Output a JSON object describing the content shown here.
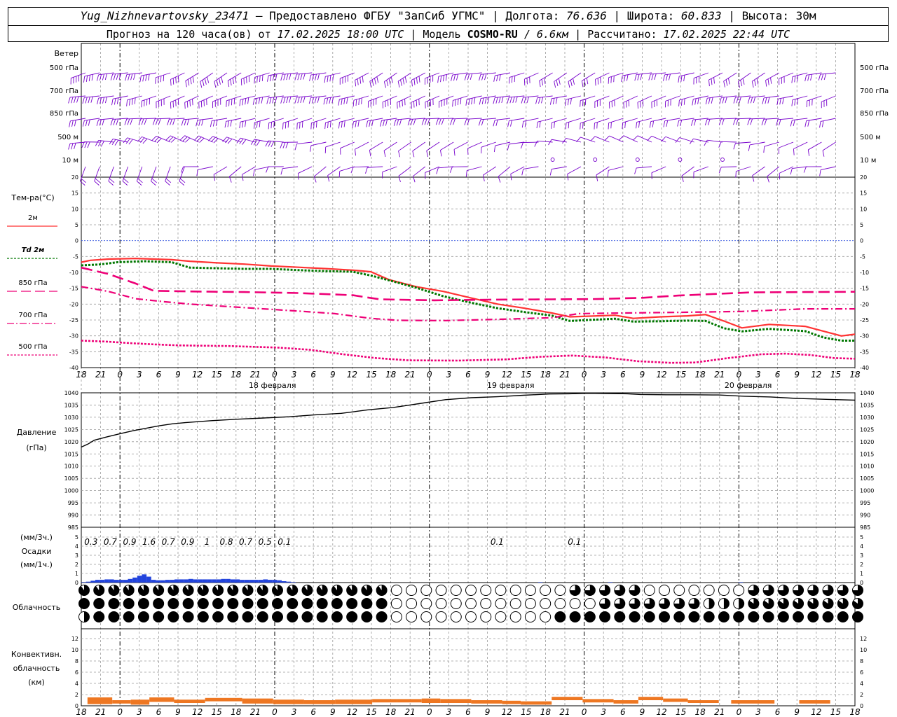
{
  "header": {
    "station": "Yug_Nizhnevartovsky_23471",
    "provided_by": "– Предоставлено ФГБУ \"ЗапСиб УГМС\"",
    "lon_label": "Долгота:",
    "lon": "76.636",
    "lat_label": "Широта:",
    "lat": "60.833",
    "alt_label": "Высота:",
    "alt": "30м",
    "sep": "|",
    "forecast_prefix": "Прогноз на 120 часа(ов) от",
    "forecast_time": "17.02.2025 18:00 UTC",
    "model_label": "Модель",
    "model": "COSMO-RU",
    "model_res": "/ 6.6км",
    "computed_label": "Рассчитано:",
    "computed": "17.02.2025 22:44 UTC"
  },
  "colors": {
    "t2m": "#ff3333",
    "td2m": "#007700",
    "upper": "#ee0077",
    "wind": "#7700cc",
    "pressure": "#000000",
    "precip": "#2244dd",
    "convective": "#ee7722",
    "zero_line": "#3355dd"
  },
  "chart_data": [
    {
      "type": "barbs",
      "title": "Ветер",
      "levels": [
        "500 гПа",
        "700 гПа",
        "850 гПа",
        "500 м",
        "10 м"
      ]
    },
    {
      "type": "line",
      "ylabel": "Тем-ра(°C)",
      "ylim": [
        -40,
        20
      ],
      "yticks": [
        20,
        15,
        10,
        5,
        0,
        -5,
        -10,
        -15,
        -20,
        -25,
        -30,
        -35,
        -40
      ],
      "x_hours": [
        0,
        120
      ],
      "xtick_labels": [
        "18",
        "21",
        "0",
        "3",
        "6",
        "9",
        "12",
        "15",
        "18",
        "21",
        "0",
        "3",
        "6",
        "9",
        "12",
        "15",
        "18",
        "21",
        "0",
        "3",
        "6",
        "9",
        "12",
        "15",
        "18",
        "21",
        "0",
        "3",
        "6",
        "9",
        "12",
        "15",
        "18",
        "21",
        "0",
        "3",
        "6",
        "9",
        "12",
        "15",
        "18",
        "21",
        "0"
      ],
      "date_labels": [
        "18 февраля",
        "19 февраля",
        "20 февраля"
      ],
      "series": [
        {
          "name": "2м",
          "points": [
            [
              0,
              -6.8
            ],
            [
              2,
              -6.2
            ],
            [
              6,
              -5.8
            ],
            [
              12,
              -5.6
            ],
            [
              20,
              -6
            ],
            [
              24,
              -6.5
            ],
            [
              30,
              -7
            ],
            [
              36,
              -7.4
            ],
            [
              42,
              -8
            ],
            [
              48,
              -8.4
            ],
            [
              54,
              -8.8
            ],
            [
              60,
              -9.3
            ],
            [
              64,
              -9.8
            ],
            [
              68,
              -12.3
            ],
            [
              74,
              -14.5
            ],
            [
              80,
              -16
            ],
            [
              86,
              -18
            ],
            [
              92,
              -20
            ],
            [
              98,
              -21.3
            ],
            [
              104,
              -22.8
            ],
            [
              108,
              -24
            ],
            [
              112,
              -23.8
            ],
            [
              118,
              -23.5
            ],
            [
              122,
              -24.5
            ],
            [
              128,
              -24
            ],
            [
              134,
              -23.7
            ],
            [
              138,
              -23.3
            ],
            [
              142,
              -25.3
            ],
            [
              146,
              -27.5
            ],
            [
              152,
              -26.4
            ],
            [
              160,
              -27
            ],
            [
              164,
              -28.5
            ],
            [
              168,
              -30
            ],
            [
              171,
              -29.5
            ]
          ]
        },
        {
          "name": "Td 2м",
          "points": [
            [
              0,
              -7.8
            ],
            [
              4,
              -7.5
            ],
            [
              8,
              -6.8
            ],
            [
              14,
              -6.5
            ],
            [
              20,
              -6.8
            ],
            [
              24,
              -8.5
            ],
            [
              30,
              -8.7
            ],
            [
              36,
              -8.9
            ],
            [
              42,
              -8.9
            ],
            [
              48,
              -9.3
            ],
            [
              54,
              -9.6
            ],
            [
              60,
              -9.8
            ],
            [
              64,
              -11
            ],
            [
              68,
              -12.5
            ],
            [
              74,
              -14.8
            ],
            [
              80,
              -17.5
            ],
            [
              86,
              -19.5
            ],
            [
              92,
              -21.3
            ],
            [
              98,
              -22.5
            ],
            [
              104,
              -23.6
            ],
            [
              108,
              -25.3
            ],
            [
              112,
              -25
            ],
            [
              118,
              -24.6
            ],
            [
              122,
              -25.5
            ],
            [
              128,
              -25.4
            ],
            [
              134,
              -25.2
            ],
            [
              138,
              -25.3
            ],
            [
              142,
              -27.6
            ],
            [
              146,
              -28.6
            ],
            [
              152,
              -27.8
            ],
            [
              160,
              -28.5
            ],
            [
              164,
              -30.5
            ],
            [
              168,
              -31.5
            ],
            [
              171,
              -31.5
            ]
          ]
        },
        {
          "name": "850 гПа",
          "points": [
            [
              0,
              -8.5
            ],
            [
              6,
              -10.5
            ],
            [
              12,
              -13.5
            ],
            [
              16,
              -15.8
            ],
            [
              24,
              -16
            ],
            [
              36,
              -16.2
            ],
            [
              48,
              -16.5
            ],
            [
              60,
              -17.2
            ],
            [
              66,
              -18.5
            ],
            [
              78,
              -18.8
            ],
            [
              90,
              -18.6
            ],
            [
              104,
              -18.5
            ],
            [
              114,
              -18.4
            ],
            [
              124,
              -18
            ],
            [
              132,
              -17.3
            ],
            [
              140,
              -16.8
            ],
            [
              148,
              -16.3
            ],
            [
              160,
              -16.2
            ],
            [
              171,
              -16.1
            ]
          ]
        },
        {
          "name": "700 гПа",
          "points": [
            [
              0,
              -14.5
            ],
            [
              6,
              -16
            ],
            [
              12,
              -18.3
            ],
            [
              18,
              -19.2
            ],
            [
              24,
              -20
            ],
            [
              36,
              -21.1
            ],
            [
              48,
              -22.2
            ],
            [
              56,
              -23
            ],
            [
              64,
              -24.5
            ],
            [
              70,
              -25.1
            ],
            [
              80,
              -25.2
            ],
            [
              92,
              -24.8
            ],
            [
              104,
              -24.3
            ],
            [
              110,
              -23
            ],
            [
              120,
              -22.8
            ],
            [
              132,
              -22.6
            ],
            [
              146,
              -22.3
            ],
            [
              160,
              -21.5
            ],
            [
              171,
              -21.5
            ]
          ]
        },
        {
          "name": "500 гПа",
          "points": [
            [
              0,
              -31.5
            ],
            [
              6,
              -31.8
            ],
            [
              12,
              -32.3
            ],
            [
              18,
              -32.7
            ],
            [
              24,
              -33
            ],
            [
              36,
              -33.2
            ],
            [
              48,
              -33.7
            ],
            [
              56,
              -34.4
            ],
            [
              64,
              -35.8
            ],
            [
              72,
              -37
            ],
            [
              80,
              -37.7
            ],
            [
              92,
              -37.8
            ],
            [
              104,
              -37.4
            ],
            [
              112,
              -36.6
            ],
            [
              120,
              -36.2
            ],
            [
              128,
              -36.8
            ],
            [
              136,
              -38
            ],
            [
              144,
              -38.5
            ],
            [
              150,
              -38.4
            ],
            [
              158,
              -37
            ],
            [
              166,
              -35.8
            ],
            [
              172,
              -35.6
            ],
            [
              178,
              -36
            ],
            [
              184,
              -37
            ],
            [
              189,
              -37.2
            ]
          ]
        }
      ]
    },
    {
      "type": "line",
      "ylabel": "Давление",
      "yunit": "(гПа)",
      "ylim": [
        985,
        1040
      ],
      "yticks": [
        1040,
        1035,
        1030,
        1025,
        1020,
        1015,
        1010,
        1005,
        1000,
        995,
        990,
        985
      ],
      "series": [
        {
          "name": "",
          "points": [
            [
              0,
              1017.8
            ],
            [
              2,
              1019
            ],
            [
              4,
              1020.6
            ],
            [
              8,
              1022
            ],
            [
              12,
              1023.3
            ],
            [
              16,
              1024.5
            ],
            [
              20,
              1025.5
            ],
            [
              24,
              1026.5
            ],
            [
              28,
              1027.3
            ],
            [
              32,
              1027.8
            ],
            [
              40,
              1028.6
            ],
            [
              48,
              1029.2
            ],
            [
              56,
              1029.7
            ],
            [
              64,
              1030.2
            ],
            [
              72,
              1031
            ],
            [
              80,
              1031.6
            ],
            [
              84,
              1032.3
            ],
            [
              88,
              1033
            ],
            [
              96,
              1034
            ],
            [
              100,
              1034.8
            ],
            [
              106,
              1036
            ],
            [
              112,
              1037.2
            ],
            [
              120,
              1038
            ],
            [
              128,
              1038.4
            ],
            [
              136,
              1039
            ],
            [
              144,
              1039.5
            ],
            [
              150,
              1039.6
            ],
            [
              156,
              1039.8
            ],
            [
              162,
              1039.7
            ],
            [
              168,
              1039.6
            ],
            [
              172,
              1039.3
            ],
            [
              180,
              1039.2
            ],
            [
              188,
              1039.2
            ],
            [
              196,
              1039.1
            ],
            [
              204,
              1038.6
            ],
            [
              212,
              1038.3
            ],
            [
              220,
              1037.7
            ],
            [
              230,
              1037.3
            ],
            [
              238,
              1037
            ]
          ]
        }
      ]
    },
    {
      "type": "bar",
      "ylabel": "Осадки",
      "yunit_top": "(мм/3ч.)",
      "yunit_bottom": "(мм/1ч.)",
      "ylim": [
        0,
        5
      ],
      "yticks": [
        5,
        4,
        3,
        2,
        1,
        0
      ],
      "sums_3h": [
        "0.3",
        "0.7",
        "0.9",
        "1.6",
        "0.7",
        "0.9",
        "1",
        "0.8",
        "0.7",
        "0.5",
        "0.1",
        "0.1",
        "0.1"
      ],
      "hourly": [
        0.05,
        0.1,
        0.2,
        0.3,
        0.3,
        0.35,
        0.35,
        0.3,
        0.3,
        0.3,
        0.4,
        0.55,
        0.75,
        0.9,
        0.65,
        0.3,
        0.25,
        0.25,
        0.3,
        0.3,
        0.35,
        0.35,
        0.35,
        0.4,
        0.35,
        0.35,
        0.35,
        0.35,
        0.35,
        0.35,
        0.4,
        0.4,
        0.35,
        0.35,
        0.3,
        0.3,
        0.3,
        0.3,
        0.3,
        0.35,
        0.3,
        0.3,
        0.25,
        0.15,
        0.1,
        0.05,
        0,
        0,
        0,
        0,
        0,
        0,
        0,
        0,
        0,
        0,
        0,
        0,
        0,
        0,
        0,
        0,
        0,
        0,
        0,
        0,
        0,
        0,
        0,
        0,
        0,
        0,
        0,
        0,
        0,
        0,
        0,
        0,
        0,
        0,
        0,
        0,
        0,
        0,
        0,
        0,
        0,
        0,
        0,
        0,
        0,
        0,
        0,
        0,
        0,
        0,
        0,
        0,
        0.05,
        0,
        0,
        0,
        0,
        0,
        0,
        0,
        0,
        0,
        0,
        0,
        0,
        0,
        0,
        0.05,
        0,
        0,
        0,
        0,
        0,
        0,
        0,
        0,
        0,
        0,
        0,
        0,
        0,
        0,
        0,
        0,
        0,
        0,
        0,
        0,
        0,
        0,
        0,
        0,
        0,
        0,
        0,
        0.05,
        0,
        0,
        0,
        0,
        0,
        0,
        0,
        0,
        0,
        0,
        0,
        0,
        0,
        0,
        0,
        0,
        0,
        0,
        0,
        0,
        0,
        0,
        0,
        0
      ]
    },
    {
      "type": "heatmap",
      "ylabel": "Облачность",
      "rows": [
        "верхняя",
        "средняя",
        "нижняя"
      ]
    },
    {
      "type": "bar",
      "ylabel": "Конвективн.",
      "ylabel2": "облачность",
      "yunit": "(км)",
      "ylim": [
        0,
        13
      ],
      "yticks": [
        12,
        10,
        8,
        6,
        4,
        2,
        0
      ],
      "segments": [
        [
          1,
          5,
          1.5,
          1.2
        ],
        [
          5,
          8,
          1.0,
          0.6
        ],
        [
          8,
          11,
          1.1,
          0.9
        ],
        [
          11,
          15,
          1.5,
          0.8
        ],
        [
          15,
          20,
          1.1,
          0.6
        ],
        [
          20,
          26,
          1.4,
          0.6
        ],
        [
          26,
          31,
          1.3,
          0.9
        ],
        [
          31,
          36,
          1.1,
          0.8
        ],
        [
          36,
          41,
          1.0,
          0.7
        ],
        [
          41,
          47,
          1.1,
          0.8
        ],
        [
          47,
          51,
          1.2,
          0.6
        ],
        [
          51,
          55,
          1.2,
          0.6
        ],
        [
          55,
          58,
          1.3,
          0.8
        ],
        [
          58,
          63,
          1.2,
          0.7
        ],
        [
          63,
          68,
          1.0,
          0.6
        ],
        [
          68,
          71,
          0.9,
          0.6
        ],
        [
          71,
          76,
          0.8,
          0.6
        ],
        [
          76,
          81,
          1.6,
          0.6
        ],
        [
          81,
          86,
          1.2,
          0.6
        ],
        [
          86,
          90,
          1.0,
          0.6
        ],
        [
          90,
          94,
          1.6,
          0.6
        ],
        [
          94,
          98,
          1.3,
          0.6
        ],
        [
          98,
          103,
          1.0,
          0.5
        ],
        [
          105,
          112,
          1.0,
          0.6
        ],
        [
          116,
          121,
          1.0,
          0.6
        ]
      ]
    }
  ]
}
